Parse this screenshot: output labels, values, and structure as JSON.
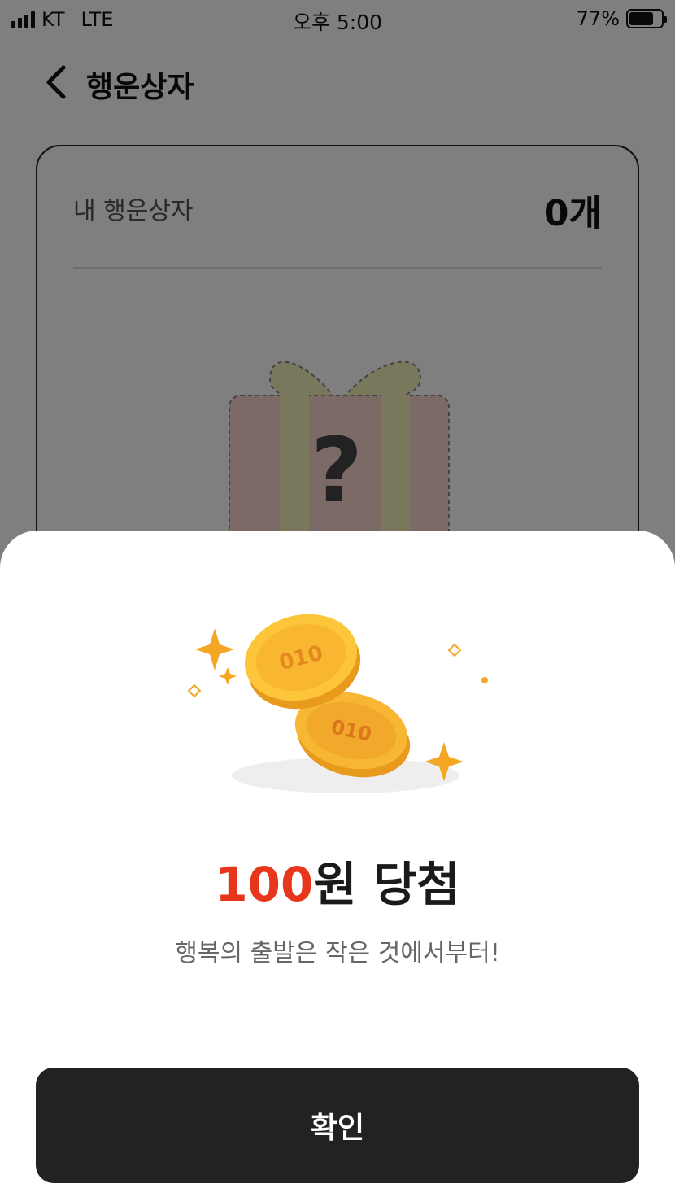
{
  "status_bar": {
    "carrier": "KT",
    "network": "LTE",
    "time": "오후 5:00",
    "battery_percent": "77%",
    "battery_level": 0.77,
    "signal_bars": 4
  },
  "nav": {
    "back_icon": "chevron-left-icon",
    "title": "행운상자"
  },
  "card": {
    "label": "내 행운상자",
    "count": "0개",
    "illustration": "mystery-gift-box-icon"
  },
  "sheet": {
    "illustration": "gold-coins-icon",
    "coin_text": "010",
    "prize_amount": "100",
    "prize_suffix": "원 당첨",
    "subtitle": "행복의 출발은 작은 것에서부터!",
    "confirm_label": "확인"
  },
  "colors": {
    "accent": "#e8361d",
    "button_bg": "#222222",
    "coin": "#f5b82e"
  }
}
